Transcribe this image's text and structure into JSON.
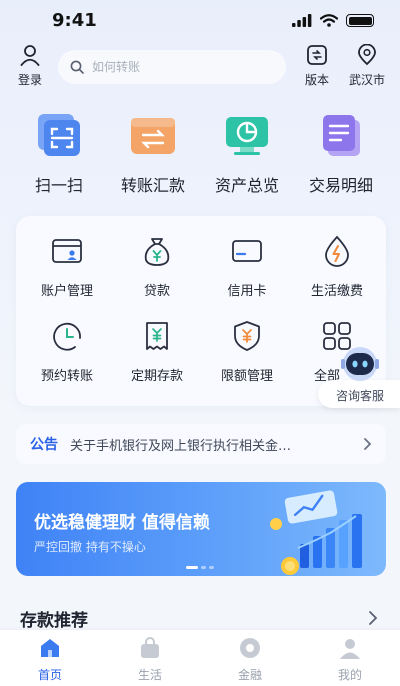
{
  "status_bar": {
    "time": "9:41"
  },
  "header": {
    "login_label": "登录",
    "search_placeholder": "如何转账",
    "version_label": "版本",
    "city_label": "武汉市"
  },
  "quick_actions": [
    {
      "label": "扫一扫",
      "icon": "scan-icon"
    },
    {
      "label": "转账汇款",
      "icon": "transfer-icon"
    },
    {
      "label": "资产总览",
      "icon": "asset-overview-icon"
    },
    {
      "label": "交易明细",
      "icon": "transaction-details-icon"
    }
  ],
  "services": [
    {
      "label": "账户管理",
      "icon": "account-card-icon"
    },
    {
      "label": "贷款",
      "icon": "loan-bag-icon"
    },
    {
      "label": "信用卡",
      "icon": "credit-card-icon"
    },
    {
      "label": "生活缴费",
      "icon": "utility-drop-icon"
    },
    {
      "label": "预约转账",
      "icon": "scheduled-clock-icon"
    },
    {
      "label": "定期存款",
      "icon": "deposit-doc-icon"
    },
    {
      "label": "限额管理",
      "icon": "limit-shield-icon"
    },
    {
      "label": "全部",
      "icon": "all-grid-icon"
    }
  ],
  "assistant": {
    "label": "咨询客服"
  },
  "notice": {
    "tag": "公告",
    "text": "关于手机银行及网上银行执行相关金…"
  },
  "banner": {
    "title": "优选稳健理财  值得信赖",
    "subtitle": "严控回撤  持有不操心"
  },
  "section": {
    "title": "存款推荐"
  },
  "tabbar": [
    {
      "label": "首页",
      "icon": "home-icon",
      "active": true
    },
    {
      "label": "生活",
      "icon": "bag-icon",
      "active": false
    },
    {
      "label": "金融",
      "icon": "finance-coin-icon",
      "active": false
    },
    {
      "label": "我的",
      "icon": "profile-icon",
      "active": false
    }
  ],
  "colors": {
    "accent": "#2a63e6",
    "banner_start": "#3f82f6",
    "banner_end": "#7eb9fc"
  }
}
